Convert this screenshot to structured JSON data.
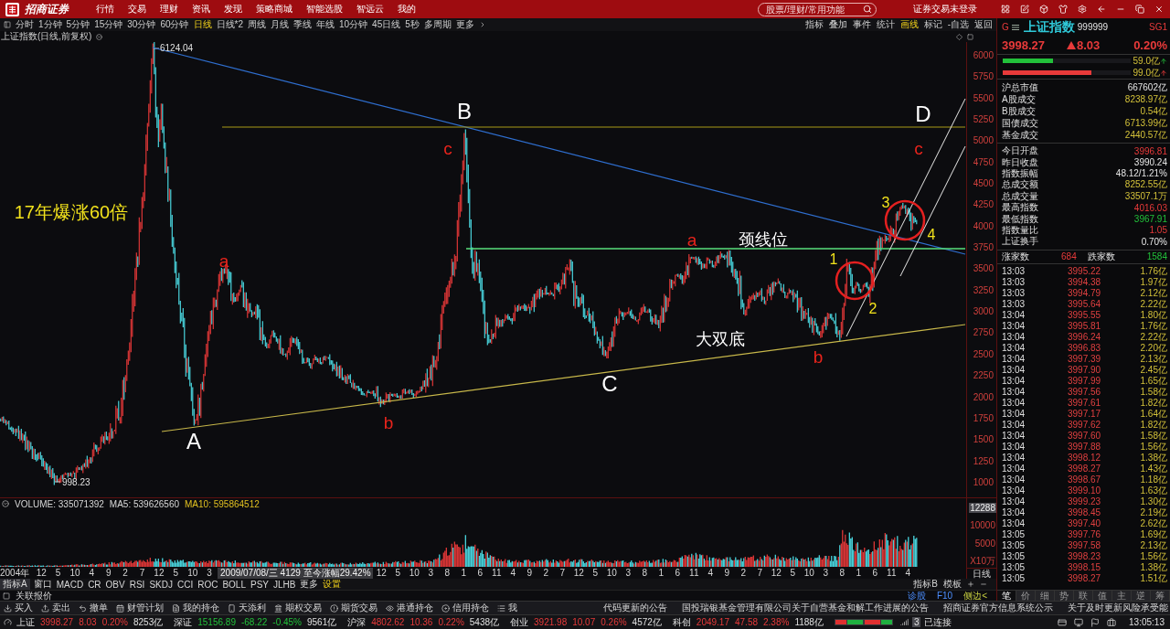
{
  "top_bar": {
    "logo": "招商证券",
    "menu": [
      "行情",
      "交易",
      "理财",
      "资讯",
      "发现",
      "策略商城",
      "智能选股",
      "智远云",
      "我的"
    ],
    "search": {
      "placeholder": "股票/理财/常用功能"
    },
    "login_status": "证券交易未登录"
  },
  "period_bar": {
    "periods": [
      {
        "label": "分时",
        "selected": false
      },
      {
        "label": "1分钟",
        "selected": false
      },
      {
        "label": "5分钟",
        "selected": false
      },
      {
        "label": "15分钟",
        "selected": false
      },
      {
        "label": "30分钟",
        "selected": false
      },
      {
        "label": "60分钟",
        "selected": false
      },
      {
        "label": "日线",
        "selected": true
      },
      {
        "label": "日线*2",
        "selected": false
      },
      {
        "label": "周线",
        "selected": false
      },
      {
        "label": "月线",
        "selected": false
      },
      {
        "label": "季线",
        "selected": false
      },
      {
        "label": "年线",
        "selected": false
      },
      {
        "label": "10分钟",
        "selected": false
      },
      {
        "label": "45日线",
        "selected": false
      },
      {
        "label": "5秒",
        "selected": false
      },
      {
        "label": "多周期",
        "selected": false
      }
    ],
    "more": "更多",
    "tools": [
      {
        "label": "指标",
        "active": false
      },
      {
        "label": "叠加",
        "active": false
      },
      {
        "label": "事件",
        "active": false
      },
      {
        "label": "统计",
        "active": false
      },
      {
        "label": "画线",
        "active": true
      },
      {
        "label": "标记",
        "active": false
      },
      {
        "label": "-自选",
        "active": false
      },
      {
        "label": "返回",
        "active": false
      }
    ]
  },
  "chart": {
    "title": "上证指数(日线,前复权)",
    "price_axis": [
      "6000",
      "5750",
      "5500",
      "5250",
      "5000",
      "4750",
      "4500",
      "4250",
      "4000",
      "3750",
      "3500",
      "3250",
      "3000",
      "2750",
      "2500",
      "2250",
      "2000",
      "1750",
      "1500",
      "1250",
      "1000"
    ],
    "peak_label": "6124.04",
    "low_label": "998.23",
    "annotations": [
      {
        "text": "B",
        "kind": "major",
        "color": "#ffffff"
      },
      {
        "text": "D",
        "kind": "major",
        "color": "#ffffff"
      },
      {
        "text": "c",
        "kind": "minor",
        "color": "#e8241c"
      },
      {
        "text": "c",
        "kind": "minor",
        "color": "#e8241c"
      },
      {
        "text": "17年爆涨60倍",
        "kind": "headline",
        "color": "#f2e21c"
      },
      {
        "text": "3",
        "kind": "count",
        "color": "#f2e21c"
      },
      {
        "text": "a",
        "kind": "minor",
        "color": "#e8241c"
      },
      {
        "text": "颈线位",
        "kind": "note",
        "color": "#ffffff"
      },
      {
        "text": "4",
        "kind": "count",
        "color": "#f2e21c"
      },
      {
        "text": "a",
        "kind": "minor",
        "color": "#e8241c"
      },
      {
        "text": "1",
        "kind": "count",
        "color": "#f2e21c"
      },
      {
        "text": "2",
        "kind": "count",
        "color": "#f2e21c"
      },
      {
        "text": "大双底",
        "kind": "note",
        "color": "#ffffff"
      },
      {
        "text": "b",
        "kind": "minor",
        "color": "#e8241c"
      },
      {
        "text": "C",
        "kind": "major",
        "color": "#ffffff"
      },
      {
        "text": "b",
        "kind": "minor",
        "color": "#e8241c"
      },
      {
        "text": "A",
        "kind": "major",
        "color": "#ffffff"
      }
    ]
  },
  "volume": {
    "readings": [
      {
        "text": "VOLUME: 335071392",
        "kind": "plain"
      },
      {
        "text": "MA5: 539626560",
        "kind": "plain"
      },
      {
        "text": "MA10: 595864512",
        "kind": "accent"
      }
    ],
    "axis": [
      {
        "label": "12288",
        "highlighted": true
      },
      {
        "label": "10000",
        "highlighted": false
      },
      {
        "label": "5000",
        "highlighted": false
      },
      {
        "label": "X10万",
        "highlighted": false
      }
    ]
  },
  "time_axis": {
    "start": "2004年",
    "before": [
      "12",
      "5",
      "10",
      "4",
      "9",
      "2",
      "7",
      "12",
      "5",
      "10",
      "3"
    ],
    "cursor": "2009/07/08/三 4129 至今涨幅29.42%",
    "after": [
      "12",
      "5",
      "10",
      "3",
      "8",
      "1",
      "6",
      "11",
      "4",
      "9",
      "2",
      "7",
      "12",
      "5",
      "10",
      "3",
      "8",
      "1",
      "6",
      "11",
      "4",
      "9",
      "2",
      "7",
      "12",
      "5",
      "10",
      "3",
      "8",
      "1",
      "6",
      "11",
      "4"
    ],
    "period": "日线"
  },
  "indicator_bar": {
    "tabs": [
      {
        "label": "指标A",
        "selected": true
      }
    ],
    "window": "窗口",
    "indicators": [
      "MACD",
      "CR",
      "OBV",
      "RSI",
      "SKDJ",
      "CCI",
      "ROC",
      "BOLL",
      "PSY",
      "JLHB"
    ],
    "more": "更多",
    "settings": "设置",
    "right_items": [
      "指标B",
      "模板"
    ]
  },
  "linked_quotes": {
    "title": "关联报价",
    "links": [
      {
        "label": "诊股",
        "active": false
      },
      {
        "label": "F10",
        "active": false
      },
      {
        "label": "侧边<",
        "active": true
      }
    ]
  },
  "quote_panel": {
    "market": "G",
    "name": "上证指数",
    "code": "999999",
    "tag": "SG1",
    "price": "3998.27",
    "change": "8.03",
    "percent": "0.20%",
    "rising": true,
    "flows": [
      {
        "value": "59.0亿",
        "level": 0.39,
        "color": "#22c03a"
      },
      {
        "value": "99.0亿",
        "level": 0.69,
        "color": "#e83a3a"
      }
    ],
    "market_stats": [
      {
        "label": "沪总市值",
        "value": "667602亿",
        "kind": "plain"
      },
      {
        "label": "A股成交",
        "value": "8238.97亿",
        "kind": "amount"
      },
      {
        "label": "B股成交",
        "value": "0.54亿",
        "kind": "amount"
      },
      {
        "label": "国债成交",
        "value": "6713.99亿",
        "kind": "amount"
      },
      {
        "label": "基金成交",
        "value": "2440.57亿",
        "kind": "amount"
      }
    ],
    "day_stats": [
      {
        "label": "今日开盘",
        "value": "3996.81",
        "kind": "rise"
      },
      {
        "label": "昨日收盘",
        "value": "3990.24",
        "kind": "plain"
      },
      {
        "label": "指数振幅",
        "value": "48.12/1.21%",
        "kind": "plain"
      },
      {
        "label": "总成交额",
        "value": "8252.55亿",
        "kind": "amount"
      },
      {
        "label": "总成交量",
        "value": "33507.1万",
        "kind": "amount"
      },
      {
        "label": "最高指数",
        "value": "4016.03",
        "kind": "rise"
      },
      {
        "label": "最低指数",
        "value": "3967.91",
        "kind": "fall"
      },
      {
        "label": "指数量比",
        "value": "1.05",
        "kind": "rise"
      },
      {
        "label": "上证换手",
        "value": "0.70%",
        "kind": "plain"
      }
    ],
    "advancers": {
      "label": "涨家数",
      "value": "684"
    },
    "decliners": {
      "label": "跌家数",
      "value": "1584"
    },
    "ticks": [
      {
        "time": "13:03",
        "price": "3995.22",
        "amount": "1.76亿"
      },
      {
        "time": "13:03",
        "price": "3994.38",
        "amount": "1.97亿"
      },
      {
        "time": "13:03",
        "price": "3994.79",
        "amount": "2.12亿"
      },
      {
        "time": "13:03",
        "price": "3995.64",
        "amount": "2.22亿"
      },
      {
        "time": "13:04",
        "price": "3995.55",
        "amount": "1.80亿"
      },
      {
        "time": "13:04",
        "price": "3995.81",
        "amount": "1.76亿"
      },
      {
        "time": "13:04",
        "price": "3996.24",
        "amount": "2.22亿"
      },
      {
        "time": "13:04",
        "price": "3996.83",
        "amount": "2.20亿"
      },
      {
        "time": "13:04",
        "price": "3997.39",
        "amount": "2.13亿"
      },
      {
        "time": "13:04",
        "price": "3997.90",
        "amount": "2.45亿"
      },
      {
        "time": "13:04",
        "price": "3997.99",
        "amount": "1.65亿"
      },
      {
        "time": "13:04",
        "price": "3997.56",
        "amount": "1.58亿"
      },
      {
        "time": "13:04",
        "price": "3997.61",
        "amount": "1.82亿"
      },
      {
        "time": "13:04",
        "price": "3997.17",
        "amount": "1.64亿"
      },
      {
        "time": "13:04",
        "price": "3997.62",
        "amount": "1.82亿"
      },
      {
        "time": "13:04",
        "price": "3997.60",
        "amount": "1.58亿"
      },
      {
        "time": "13:04",
        "price": "3997.88",
        "amount": "1.56亿"
      },
      {
        "time": "13:04",
        "price": "3998.12",
        "amount": "1.38亿"
      },
      {
        "time": "13:04",
        "price": "3998.27",
        "amount": "1.43亿"
      },
      {
        "time": "13:04",
        "price": "3998.67",
        "amount": "1.18亿"
      },
      {
        "time": "13:04",
        "price": "3999.10",
        "amount": "1.63亿"
      },
      {
        "time": "13:04",
        "price": "3999.23",
        "amount": "1.30亿"
      },
      {
        "time": "13:04",
        "price": "3998.45",
        "amount": "2.19亿"
      },
      {
        "time": "13:04",
        "price": "3997.40",
        "amount": "2.62亿"
      },
      {
        "time": "13:05",
        "price": "3997.76",
        "amount": "1.69亿"
      },
      {
        "time": "13:05",
        "price": "3997.58",
        "amount": "2.13亿"
      },
      {
        "time": "13:05",
        "price": "3998.23",
        "amount": "1.56亿"
      },
      {
        "time": "13:05",
        "price": "3998.15",
        "amount": "1.38亿"
      },
      {
        "time": "13:05",
        "price": "3998.27",
        "amount": "1.51亿"
      }
    ],
    "tabs": [
      {
        "label": "笔",
        "selected": true
      },
      {
        "label": "价",
        "selected": false
      },
      {
        "label": "细",
        "selected": false
      },
      {
        "label": "势",
        "selected": false
      },
      {
        "label": "联",
        "selected": false
      },
      {
        "label": "值",
        "selected": false
      },
      {
        "label": "主",
        "selected": false
      },
      {
        "label": "逆",
        "selected": false
      },
      {
        "label": "筹",
        "selected": false
      }
    ]
  },
  "action_bar": {
    "actions": [
      "买入",
      "卖出",
      "撤单",
      "财管计划",
      "我的持仓",
      "天添利",
      "期权交易",
      "期货交易",
      "港通持仓",
      "信用持仓",
      "我"
    ],
    "news": [
      "代码更新的公告",
      "国投瑞银基金管理有限公司关于自营基金和解工作进展的公告",
      "招商证券官方信息系统公示",
      "关于及时更新风险承受能"
    ]
  },
  "status_bar": {
    "indices": [
      {
        "name": "上证",
        "price": "3998.27",
        "change": "8.03",
        "percent": "0.20%",
        "turnover": "8253亿",
        "rising": true
      },
      {
        "name": "深证",
        "price": "15156.89",
        "change": "-68.22",
        "percent": "-0.45%",
        "turnover": "9561亿",
        "rising": false
      },
      {
        "name": "沪深",
        "price": "4802.62",
        "change": "10.36",
        "percent": "0.22%",
        "turnover": "5438亿",
        "rising": true
      },
      {
        "name": "创业",
        "price": "3921.98",
        "change": "10.07",
        "percent": "0.26%",
        "turnover": "4572亿",
        "rising": true
      },
      {
        "name": "科创",
        "price": "2049.17",
        "change": "47.58",
        "percent": "2.38%",
        "turnover": "1188亿",
        "rising": true
      }
    ],
    "server": "3",
    "connection": "已连接",
    "clock": "13:05:13"
  }
}
